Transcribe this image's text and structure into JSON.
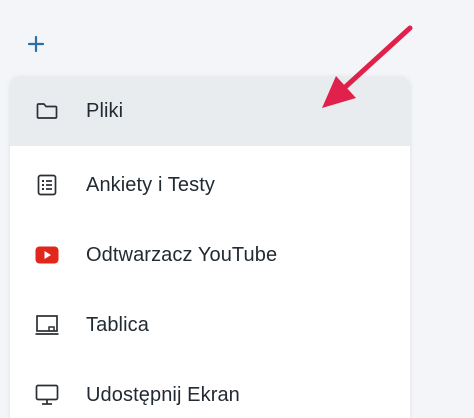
{
  "toolbar": {
    "add_icon": "plus-icon"
  },
  "menu": {
    "items": [
      {
        "label": "Pliki",
        "icon": "folder-icon",
        "active": true
      },
      {
        "label": "Ankiety i Testy",
        "icon": "list-icon",
        "active": false
      },
      {
        "label": "Odtwarzacz YouTube",
        "icon": "youtube-icon",
        "active": false
      },
      {
        "label": "Tablica",
        "icon": "whiteboard-icon",
        "active": false
      },
      {
        "label": "Udostępnij Ekran",
        "icon": "monitor-icon",
        "active": false
      }
    ]
  },
  "colors": {
    "background": "#f3f5f8",
    "menu_background": "#ffffff",
    "active_item_background": "#e9ecef",
    "plus_icon": "#2b6fa6",
    "youtube_red": "#e1261c",
    "annotation_arrow": "#e0214b"
  }
}
